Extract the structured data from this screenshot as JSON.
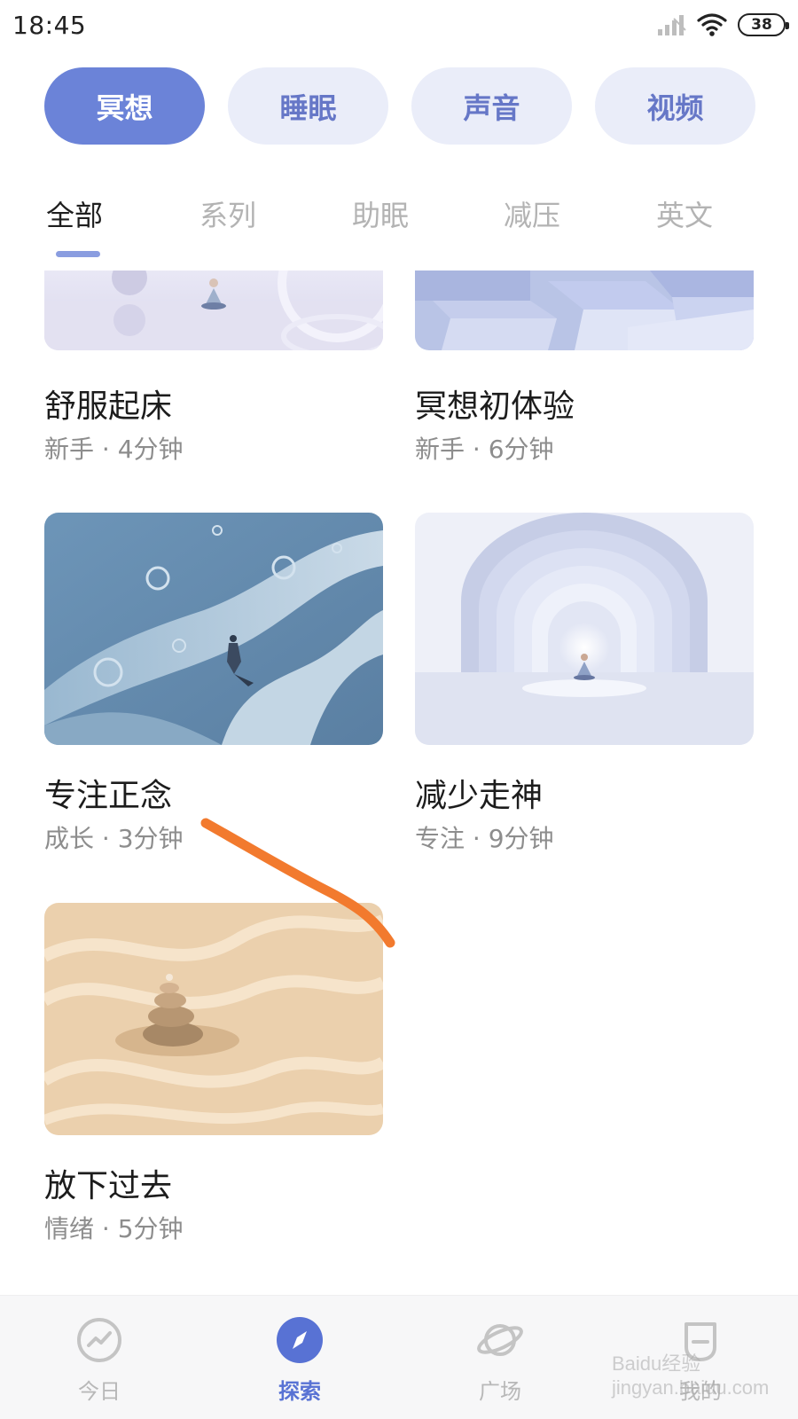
{
  "status_bar": {
    "time": "18:45",
    "battery": "38",
    "icons": [
      "signal-icon",
      "wifi-icon",
      "battery-icon"
    ]
  },
  "primary_tabs": [
    {
      "label": "冥想",
      "active": true
    },
    {
      "label": "睡眠",
      "active": false
    },
    {
      "label": "声音",
      "active": false
    },
    {
      "label": "视频",
      "active": false
    }
  ],
  "sub_tabs": [
    {
      "label": "全部",
      "active": true
    },
    {
      "label": "系列",
      "active": false
    },
    {
      "label": "助眠",
      "active": false
    },
    {
      "label": "减压",
      "active": false
    },
    {
      "label": "英文",
      "active": false
    }
  ],
  "cards": [
    {
      "title": "舒服起床",
      "meta": "新手 · 4分钟"
    },
    {
      "title": "冥想初体验",
      "meta": "新手 · 6分钟"
    },
    {
      "title": "专注正念",
      "meta": "成长 · 3分钟"
    },
    {
      "title": "减少走神",
      "meta": "专注 · 9分钟"
    },
    {
      "title": "放下过去",
      "meta": "情绪 · 5分钟"
    }
  ],
  "bottom_nav": [
    {
      "label": "今日",
      "icon": "trend-icon",
      "active": false
    },
    {
      "label": "探索",
      "icon": "compass-icon",
      "active": true
    },
    {
      "label": "广场",
      "icon": "planet-icon",
      "active": false
    },
    {
      "label": "我的",
      "icon": "profile-icon",
      "active": false
    }
  ],
  "watermark": "Baidu经验 jingyan.baidu.com",
  "colors": {
    "accent": "#6b83d8",
    "pill_inactive_bg": "#eaedf9",
    "pill_inactive_text": "#6677c7",
    "nav_active": "#5872d4",
    "annotation_stroke": "#f27a2e"
  }
}
